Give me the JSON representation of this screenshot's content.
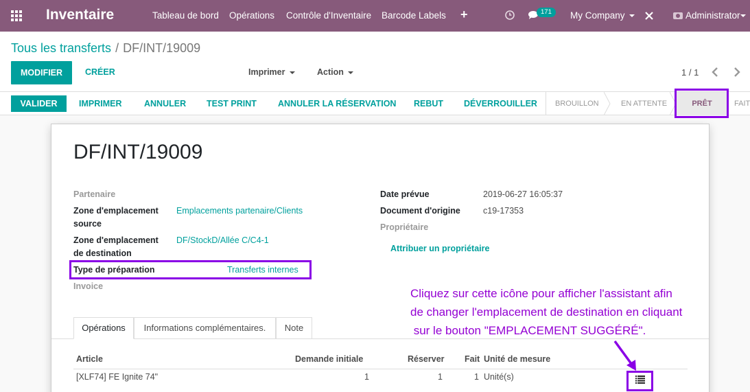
{
  "navbar": {
    "app_name": "Inventaire",
    "menu": [
      "Tableau de bord",
      "Opérations",
      "Contrôle d'Inventaire",
      "Barcode Labels"
    ],
    "plus": "+",
    "message_count": "171",
    "company": "My Company",
    "user": "Administrator",
    "bg_color": "#875a7b"
  },
  "control": {
    "breadcrumb_parent": "Tous les transferts",
    "breadcrumb_sep": "/",
    "breadcrumb_current": "DF/INT/19009",
    "modifier": "MODIFIER",
    "creer": "CRÉER",
    "imprimer": "Imprimer",
    "action": "Action",
    "pager": "1 / 1"
  },
  "statusbar": {
    "valider": "VALIDER",
    "buttons": [
      "IMPRIMER",
      "ANNULER",
      "TEST PRINT",
      "ANNULER LA RÉSERVATION",
      "REBUT",
      "DÉVERROUILLER"
    ],
    "stages": [
      "BROUILLON",
      "EN ATTENTE",
      "PRÊT",
      "FAIT"
    ],
    "active_stage": "PRÊT"
  },
  "form": {
    "title": "DF/INT/19009",
    "partenaire_label": "Partenaire",
    "src_label_1": "Zone d'emplacement",
    "src_label_2": "source",
    "src_value": "Emplacements partenaire/Clients",
    "dst_label_1": "Zone d'emplacement",
    "dst_label_2": "de destination",
    "dst_value": "DF/StockD/Allée C/C4-1",
    "type_label": "Type de préparation",
    "type_value": "Transferts internes",
    "invoice_label": "Invoice",
    "date_label": "Date prévue",
    "date_value": "2019-06-27 16:05:37",
    "origin_label": "Document d'origine",
    "origin_value": "c19-17353",
    "owner_label": "Propriétaire",
    "assign_owner": "Attribuer un propriétaire"
  },
  "tabs": [
    "Opérations",
    "Informations complémentaires.",
    "Note"
  ],
  "table": {
    "headers": [
      "Article",
      "Demande initiale",
      "Réserver",
      "Fait",
      "Unité de mesure"
    ],
    "rows": [
      {
        "article": "[XLF74] FE Ignite 74\"",
        "demande": "1",
        "reserver": "1",
        "fait": "1",
        "uom": "Unité(s)"
      }
    ]
  },
  "annotation": {
    "lines": [
      "Cliquez sur cette icône pour afficher l'assistant afin",
      "de changer l'emplacement de destination en cliquant",
      " sur le bouton \"EMPLACEMENT SUGGÉRÉ\"."
    ],
    "color": "#9400d3"
  }
}
